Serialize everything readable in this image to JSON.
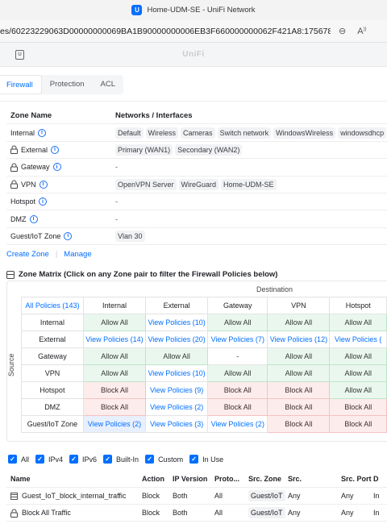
{
  "window": {
    "title": "Home-UDM-SE - UniFi Network",
    "app_icon_letter": "U"
  },
  "addressbar": {
    "url": "es/60223229063D00000000069BA1B90000000006EB3F660000000062F421A8:1756788559/n..."
  },
  "app_header": {
    "brand": "UniFi"
  },
  "tabs": [
    {
      "label": "Firewall"
    },
    {
      "label": "Protection"
    },
    {
      "label": "ACL"
    }
  ],
  "zones": {
    "header": {
      "name": "Zone Name",
      "networks": "Networks / Interfaces"
    },
    "rows": [
      {
        "name": "Internal",
        "locked": false,
        "chips": [
          "Default",
          "Wireless",
          "Cameras",
          "Switch network",
          "WindowsWireless",
          "windowsdhcp"
        ]
      },
      {
        "name": "External",
        "locked": true,
        "chips": [
          "Primary (WAN1)",
          "Secondary (WAN2)"
        ]
      },
      {
        "name": "Gateway",
        "locked": true,
        "dash": "-"
      },
      {
        "name": "VPN",
        "locked": true,
        "chips": [
          "OpenVPN Server",
          "WireGuard",
          "Home-UDM-SE"
        ]
      },
      {
        "name": "Hotspot",
        "locked": false,
        "dash": "-"
      },
      {
        "name": "DMZ",
        "locked": false,
        "dash": "-"
      },
      {
        "name": "Guest/IoT Zone",
        "locked": false,
        "chips": [
          "Vlan 30"
        ]
      }
    ]
  },
  "zone_links": {
    "create": "Create Zone",
    "separator": "|",
    "manage": "Manage"
  },
  "matrix": {
    "title": "Zone Matrix (Click on any Zone pair to filter the Firewall Policies below)",
    "destination_label": "Destination",
    "source_label": "Source",
    "all_policies": "All Policies (143)",
    "columns": [
      "Internal",
      "External",
      "Gateway",
      "VPN",
      "Hotspot"
    ],
    "rows": [
      {
        "label": "Internal",
        "cells": [
          {
            "t": "Allow All",
            "k": "allow"
          },
          {
            "t": "View Policies (10)",
            "k": "view"
          },
          {
            "t": "Allow All",
            "k": "allow"
          },
          {
            "t": "Allow All",
            "k": "allow"
          },
          {
            "t": "Allow All",
            "k": "allow"
          }
        ]
      },
      {
        "label": "External",
        "cells": [
          {
            "t": "View Policies (14)",
            "k": "view"
          },
          {
            "t": "View Policies (20)",
            "k": "view"
          },
          {
            "t": "View Policies (7)",
            "k": "view"
          },
          {
            "t": "View Policies (12)",
            "k": "view"
          },
          {
            "t": "View Policies (",
            "k": "view"
          }
        ]
      },
      {
        "label": "Gateway",
        "cells": [
          {
            "t": "Allow All",
            "k": "allow"
          },
          {
            "t": "Allow All",
            "k": "allow"
          },
          {
            "t": "-",
            "k": "none"
          },
          {
            "t": "Allow All",
            "k": "allow"
          },
          {
            "t": "Allow All",
            "k": "allow"
          }
        ]
      },
      {
        "label": "VPN",
        "cells": [
          {
            "t": "Allow All",
            "k": "allow"
          },
          {
            "t": "View Policies (10)",
            "k": "view"
          },
          {
            "t": "Allow All",
            "k": "allow"
          },
          {
            "t": "Allow All",
            "k": "allow"
          },
          {
            "t": "Allow All",
            "k": "allow"
          }
        ]
      },
      {
        "label": "Hotspot",
        "cells": [
          {
            "t": "Block All",
            "k": "block"
          },
          {
            "t": "View Policies (9)",
            "k": "view"
          },
          {
            "t": "Block All",
            "k": "block"
          },
          {
            "t": "Block All",
            "k": "block"
          },
          {
            "t": "Allow All",
            "k": "allow"
          }
        ]
      },
      {
        "label": "DMZ",
        "cells": [
          {
            "t": "Block All",
            "k": "block"
          },
          {
            "t": "View Policies (2)",
            "k": "view"
          },
          {
            "t": "Block All",
            "k": "block"
          },
          {
            "t": "Block All",
            "k": "block"
          },
          {
            "t": "Block All",
            "k": "block"
          }
        ]
      },
      {
        "label": "Guest/IoT Zone",
        "cells": [
          {
            "t": "View Policies (2)",
            "k": "viewsel"
          },
          {
            "t": "View Policies (3)",
            "k": "view"
          },
          {
            "t": "View Policies (2)",
            "k": "view"
          },
          {
            "t": "Block All",
            "k": "block"
          },
          {
            "t": "Block All",
            "k": "block"
          }
        ]
      }
    ]
  },
  "filters": [
    {
      "label": "All",
      "checked": true
    },
    {
      "label": "IPv4",
      "checked": true
    },
    {
      "label": "IPv6",
      "checked": true
    },
    {
      "label": "Built-In",
      "checked": true
    },
    {
      "label": "Custom",
      "checked": true
    },
    {
      "label": "In Use",
      "checked": true
    }
  ],
  "policies": {
    "header": [
      "Name",
      "Action",
      "IP Version",
      "Proto...",
      "Src. Zone",
      "Src.",
      "Src. Port",
      "D"
    ],
    "rows": [
      {
        "icon": "table-icon",
        "name": "Guest_IoT_block_internal_traffic",
        "action": "Block",
        "ip": "Both",
        "proto": "All",
        "zone": "Guest/IoT",
        "src": "Any",
        "port": "Any",
        "d": "In"
      },
      {
        "icon": "lock-icon",
        "name": "Block All Traffic",
        "action": "Block",
        "ip": "Both",
        "proto": "All",
        "zone": "Guest/IoT",
        "src": "Any",
        "port": "Any",
        "d": "In"
      }
    ]
  },
  "colors": {
    "accent": "#006fff",
    "allow_bg": "#eaf7ee",
    "block_bg": "#fdecec"
  }
}
